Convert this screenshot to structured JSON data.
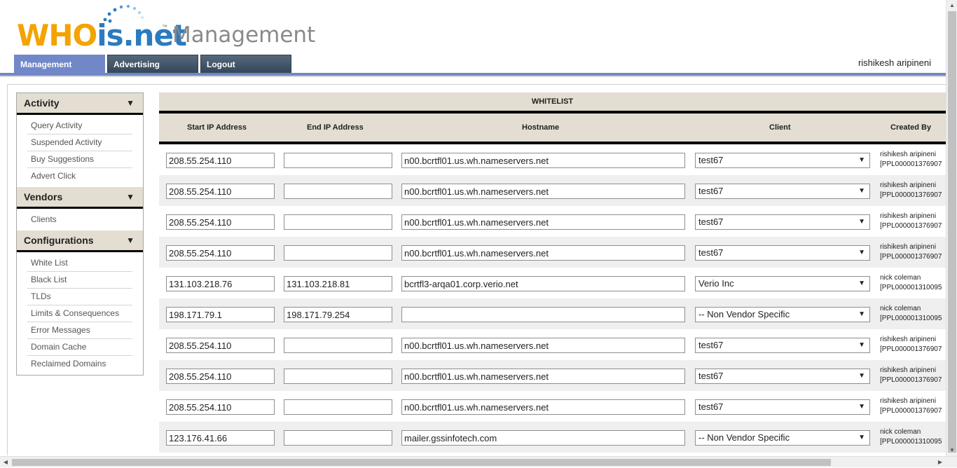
{
  "logo": {
    "brand_part1": "WHO",
    "brand_part2": "is.net",
    "tm": "™",
    "product": "Management"
  },
  "nav_tabs": [
    {
      "label": "Management",
      "active": true
    },
    {
      "label": "Advertising",
      "active": false
    },
    {
      "label": "Logout",
      "active": false
    }
  ],
  "user": {
    "name": "rishikesh aripineni"
  },
  "sidebar": {
    "arrow_icon": "▼",
    "sections": [
      {
        "title": "Activity",
        "items": [
          "Query Activity",
          "Suspended Activity",
          "Buy Suggestions",
          "Advert Click"
        ]
      },
      {
        "title": "Vendors",
        "items": [
          "Clients"
        ]
      },
      {
        "title": "Configurations",
        "items": [
          "White List",
          "Black List",
          "TLDs",
          "Limits & Consequences",
          "Error Messages",
          "Domain Cache",
          "Reclaimed Domains"
        ]
      }
    ]
  },
  "table": {
    "title": "WHITELIST",
    "columns": [
      "Start IP Address",
      "End IP Address",
      "Hostname",
      "Client",
      "Created By"
    ],
    "rows": [
      {
        "start": "208.55.254.110",
        "end": "",
        "hostname": "n00.bcrtfl01.us.wh.nameservers.net",
        "client": "test67",
        "created_name": "rishikesh aripineni",
        "created_id": "[PPL000001376907"
      },
      {
        "start": "208.55.254.110",
        "end": "",
        "hostname": "n00.bcrtfl01.us.wh.nameservers.net",
        "client": "test67",
        "created_name": "rishikesh aripineni",
        "created_id": "[PPL000001376907"
      },
      {
        "start": "208.55.254.110",
        "end": "",
        "hostname": "n00.bcrtfl01.us.wh.nameservers.net",
        "client": "test67",
        "created_name": "rishikesh aripineni",
        "created_id": "[PPL000001376907"
      },
      {
        "start": "208.55.254.110",
        "end": "",
        "hostname": "n00.bcrtfl01.us.wh.nameservers.net",
        "client": "test67",
        "created_name": "rishikesh aripineni",
        "created_id": "[PPL000001376907"
      },
      {
        "start": "131.103.218.76",
        "end": "131.103.218.81",
        "hostname": "bcrtfl3-arqa01.corp.verio.net",
        "client": "Verio Inc",
        "created_name": "nick coleman",
        "created_id": "[PPL000001310095"
      },
      {
        "start": "198.171.79.1",
        "end": "198.171.79.254",
        "hostname": "",
        "client": "-- Non Vendor Specific",
        "created_name": "nick coleman",
        "created_id": "[PPL000001310095"
      },
      {
        "start": "208.55.254.110",
        "end": "",
        "hostname": "n00.bcrtfl01.us.wh.nameservers.net",
        "client": "test67",
        "created_name": "rishikesh aripineni",
        "created_id": "[PPL000001376907"
      },
      {
        "start": "208.55.254.110",
        "end": "",
        "hostname": "n00.bcrtfl01.us.wh.nameservers.net",
        "client": "test67",
        "created_name": "rishikesh aripineni",
        "created_id": "[PPL000001376907"
      },
      {
        "start": "208.55.254.110",
        "end": "",
        "hostname": "n00.bcrtfl01.us.wh.nameservers.net",
        "client": "test67",
        "created_name": "rishikesh aripineni",
        "created_id": "[PPL000001376907"
      },
      {
        "start": "123.176.41.66",
        "end": "",
        "hostname": "mailer.gssinfotech.com",
        "client": "-- Non Vendor Specific",
        "created_name": "nick coleman",
        "created_id": "[PPL000001310095"
      }
    ]
  },
  "colors": {
    "accent": "#7187c8",
    "nav_dark": "#34475a",
    "header_bg": "#e3ddd2",
    "logo_orange": "#f4a300",
    "logo_blue": "#2b7bbf"
  }
}
